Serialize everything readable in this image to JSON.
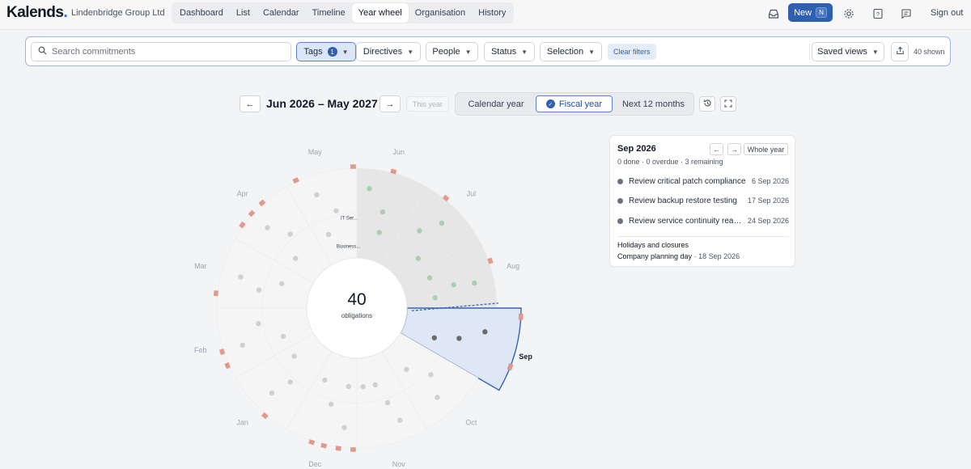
{
  "app": {
    "logo": "Kalends",
    "logo_dot": ".",
    "org": "Lindenbridge Group Ltd"
  },
  "nav": {
    "tabs": [
      {
        "label": "Dashboard",
        "active": false
      },
      {
        "label": "List",
        "active": false
      },
      {
        "label": "Calendar",
        "active": false
      },
      {
        "label": "Timeline",
        "active": false
      },
      {
        "label": "Year wheel",
        "active": true
      },
      {
        "label": "Organisation",
        "active": false
      },
      {
        "label": "History",
        "active": false
      }
    ],
    "new_label": "New",
    "new_kbd": "N",
    "help_glyph": "?",
    "signout": "Sign out",
    "icons": [
      "inbox-icon",
      "gear-icon",
      "help-icon",
      "feedback-icon"
    ]
  },
  "filters": {
    "search_placeholder": "Search commitments",
    "search_value": "",
    "tags": {
      "label": "Tags",
      "count": "1"
    },
    "directives": "Directives",
    "people": "People",
    "status": "Status",
    "selection": "Selection",
    "clear": "Clear filters",
    "saved_views": "Saved views",
    "shown": "40 shown"
  },
  "period": {
    "label": "Jun 2026 – May 2027",
    "this_year": "This year",
    "prev_glyph": "←",
    "next_glyph": "→",
    "modes": [
      {
        "label": "Calendar year",
        "active": false
      },
      {
        "label": "Fiscal year",
        "active": true
      },
      {
        "label": "Next 12 months",
        "active": false
      }
    ]
  },
  "wheel": {
    "total": "40",
    "total_label": "obligations",
    "selected_month": "Sep",
    "months": [
      "Jun",
      "Jul",
      "Aug",
      "Sep",
      "Oct",
      "Nov",
      "Dec",
      "Jan",
      "Feb",
      "Mar",
      "Apr",
      "May"
    ],
    "ring_labels": [
      "IT Ser...",
      "Business..."
    ],
    "colors": {
      "past": "#e6e6e6",
      "future": "#f5f5f5",
      "selected": "#dde7f5",
      "selected_stroke": "#3a63b0",
      "marker": "#e2998c",
      "dot_done": "#a9cfb2",
      "dot_future": "#d0d0d0",
      "dot_selected": "#6b6b6b"
    },
    "segments": [
      {
        "month": "Jun",
        "state": "past",
        "dots": [
          [
            0.78,
            0.2
          ],
          [
            0.55,
            0.5
          ],
          [
            0.32,
            0.55
          ]
        ],
        "markers": [
          0.5
        ]
      },
      {
        "month": "Jul",
        "state": "past",
        "dots": [
          [
            0.78,
            0.5
          ],
          [
            0.55,
            0.3
          ],
          [
            0.32,
            0.7
          ]
        ],
        "markers": [
          0.3
        ]
      },
      {
        "month": "Aug",
        "state": "past",
        "dots": [
          [
            0.78,
            0.6
          ],
          [
            0.55,
            0.55
          ],
          [
            0.32,
            0.25
          ],
          [
            0.32,
            0.75
          ]
        ],
        "markers": [
          0.35
        ]
      },
      {
        "month": "Sep",
        "state": "selected",
        "dots": [
          [
            0.78,
            0.35
          ],
          [
            0.55,
            0.55
          ],
          [
            0.32,
            0.7
          ]
        ],
        "markers": [
          0.1,
          0.7
        ]
      },
      {
        "month": "Oct",
        "state": "future",
        "dots": [
          [
            0.78,
            0.6
          ],
          [
            0.55,
            0.4
          ],
          [
            0.32,
            0.7
          ]
        ],
        "markers": []
      },
      {
        "month": "Nov",
        "state": "future",
        "dots": [
          [
            0.78,
            0.3
          ],
          [
            0.55,
            0.4
          ],
          [
            0.32,
            0.55
          ],
          [
            0.32,
            0.85
          ]
        ],
        "markers": []
      },
      {
        "month": "Dec",
        "state": "future",
        "dots": [
          [
            0.78,
            0.2
          ],
          [
            0.55,
            0.5
          ],
          [
            0.32,
            0.2
          ],
          [
            0.32,
            0.8
          ]
        ],
        "markers": [
          0.05,
          0.25,
          0.45,
          0.62
        ]
      },
      {
        "month": "Jan",
        "state": "future",
        "dots": [
          [
            0.78,
            0.5
          ],
          [
            0.55,
            0.4
          ],
          [
            0.32,
            0.75
          ]
        ],
        "markers": [
          0.35
        ]
      },
      {
        "month": "Feb",
        "state": "future",
        "dots": [
          [
            0.78,
            0.4
          ],
          [
            0.55,
            0.7
          ],
          [
            0.32,
            0.3
          ]
        ],
        "markers": [
          0.2,
          0.4
        ]
      },
      {
        "month": "Mar",
        "state": "future",
        "dots": [
          [
            0.78,
            0.5
          ],
          [
            0.55,
            0.35
          ],
          [
            0.32,
            0.6
          ]
        ],
        "markers": [
          0.2
        ]
      },
      {
        "month": "Apr",
        "state": "future",
        "dots": [
          [
            0.78,
            0.4
          ],
          [
            0.55,
            0.6
          ],
          [
            0.32,
            0.3
          ]
        ],
        "markers": [
          0.2,
          0.4,
          0.6
        ]
      },
      {
        "month": "May",
        "state": "future",
        "dots": [
          [
            0.78,
            0.35
          ],
          [
            0.55,
            0.6
          ],
          [
            0.32,
            0.3
          ]
        ],
        "markers": [
          0.15,
          0.95
        ]
      }
    ]
  },
  "panel": {
    "title": "Sep 2026",
    "prev_glyph": "←",
    "next_glyph": "→",
    "whole_year": "Whole year",
    "summary": "0 done · 0 overdue · 3 remaining",
    "items": [
      {
        "name": "Review critical patch compliance",
        "date": "6 Sep 2026"
      },
      {
        "name": "Review backup restore testing",
        "date": "17 Sep 2026"
      },
      {
        "name": "Review service continuity readiness",
        "date": "24 Sep 2026"
      }
    ],
    "holidays_title": "Holidays and closures",
    "holiday": {
      "name": "Company planning day",
      "sep": " · ",
      "date": "18 Sep 2026"
    }
  }
}
